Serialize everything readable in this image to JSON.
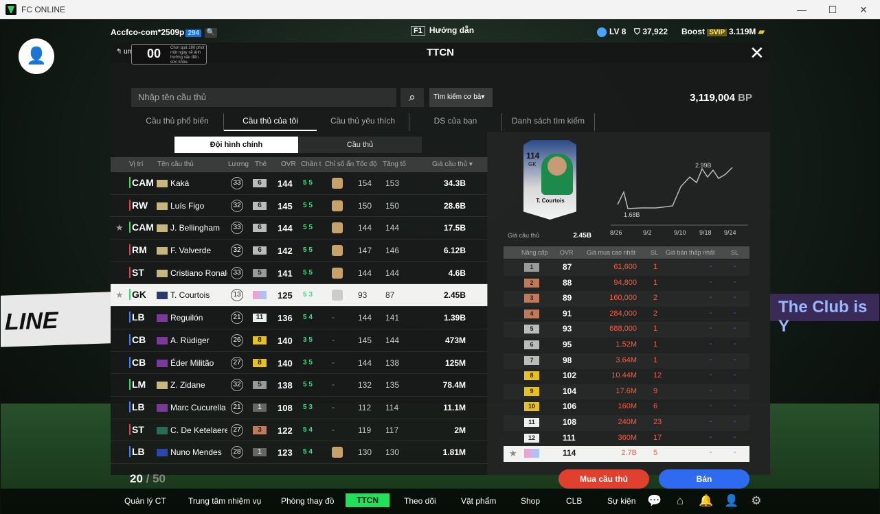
{
  "window": {
    "title": "FC ONLINE"
  },
  "top": {
    "account": "Accfco-com*2509p",
    "account_level": "294",
    "guide_key": "F1",
    "guide_label": "Hướng dẫn",
    "level": "LV 8",
    "coins": "37,922",
    "boost": "Boost",
    "svip": "SVIP",
    "bp": "3.119M"
  },
  "panel": {
    "title": "TTCN",
    "back_label": "ung tâ",
    "timer_big": "00",
    "timer_small": "Chơi quá 180 phút một ngày sẽ ảnh hưởng xấu đến sức khỏe.",
    "search_placeholder": "Nhập tên cầu thủ",
    "search_mode": "Tìm kiếm cơ bả",
    "bp_value": "3,119,004",
    "bp_unit": "BP"
  },
  "tabs": [
    "Cầu thủ phổ biến",
    "Cầu thủ của tôi",
    "Cầu thủ yêu thích",
    "DS của bạn",
    "Danh sách tìm kiếm"
  ],
  "subtabs": [
    "Đội hình chính",
    "Cầu thủ"
  ],
  "table_headers": {
    "pos": "Vị trí",
    "name": "Tên cầu thủ",
    "wage": "Lương",
    "season": "Thẻ",
    "ovr": "OVR",
    "foot": "Chân t",
    "chem": "Chỉ số ẩn",
    "spd": "Tốc độ",
    "acc": "Tăng tố",
    "price": "Giá cầu thủ ▾"
  },
  "players": [
    {
      "pos": "CAM",
      "name": "Kaká",
      "wage": "33",
      "lvl": "6",
      "ovr": "144",
      "foot": "5 5",
      "spd": "154",
      "acc": "153",
      "price": "34.3B"
    },
    {
      "pos": "RW",
      "name": "Luís Figo",
      "wage": "32",
      "lvl": "6",
      "ovr": "145",
      "foot": "5 5",
      "spd": "150",
      "acc": "150",
      "price": "28.6B"
    },
    {
      "pos": "CAM",
      "name": "J. Bellingham",
      "wage": "33",
      "lvl": "6",
      "ovr": "144",
      "foot": "5 5",
      "spd": "144",
      "acc": "144",
      "price": "17.5B"
    },
    {
      "pos": "RM",
      "name": "F. Valverde",
      "wage": "32",
      "lvl": "6",
      "ovr": "142",
      "foot": "5 5",
      "spd": "147",
      "acc": "146",
      "price": "6.12B"
    },
    {
      "pos": "ST",
      "name": "Cristiano Ronaldo",
      "wage": "33",
      "lvl": "5",
      "ovr": "141",
      "foot": "5 5",
      "spd": "144",
      "acc": "144",
      "price": "4.6B"
    },
    {
      "pos": "GK",
      "name": "T. Courtois",
      "wage": "13",
      "lvl": "",
      "ovr": "125",
      "foot": "5 3",
      "spd": "93",
      "acc": "87",
      "price": "2.45B"
    },
    {
      "pos": "LB",
      "name": "Reguilón",
      "wage": "21",
      "lvl": "11",
      "ovr": "136",
      "foot": "5 4",
      "spd": "144",
      "acc": "141",
      "price": "1.39B"
    },
    {
      "pos": "CB",
      "name": "A. Rüdiger",
      "wage": "26",
      "lvl": "8",
      "ovr": "140",
      "foot": "3 5",
      "spd": "145",
      "acc": "144",
      "price": "473M"
    },
    {
      "pos": "CB",
      "name": "Éder Militão",
      "wage": "27",
      "lvl": "8",
      "ovr": "140",
      "foot": "3 5",
      "spd": "144",
      "acc": "138",
      "price": "125M"
    },
    {
      "pos": "LM",
      "name": "Z. Zidane",
      "wage": "32",
      "lvl": "5",
      "ovr": "138",
      "foot": "5 5",
      "spd": "132",
      "acc": "135",
      "price": "78.4M"
    },
    {
      "pos": "LB",
      "name": "Marc Cucurella",
      "wage": "21",
      "lvl": "1",
      "ovr": "108",
      "foot": "5 3",
      "spd": "112",
      "acc": "114",
      "price": "11.1M"
    },
    {
      "pos": "ST",
      "name": "C. De Ketelaere",
      "wage": "27",
      "lvl": "3",
      "ovr": "122",
      "foot": "5 4",
      "spd": "119",
      "acc": "117",
      "price": "2M"
    },
    {
      "pos": "LB",
      "name": "Nuno Mendes",
      "wage": "28",
      "lvl": "1",
      "ovr": "123",
      "foot": "5 4",
      "spd": "130",
      "acc": "130",
      "price": "1.81M"
    }
  ],
  "pager": {
    "current": "20",
    "total": "/ 50"
  },
  "card": {
    "ovr": "114",
    "pos": "GK",
    "name": "T. Courtois",
    "price_label": "Giá cầu thủ",
    "price": "2.45B"
  },
  "chart_data": {
    "type": "line",
    "x": [
      "8/26",
      "9/2",
      "9/10",
      "9/18",
      "9/24"
    ],
    "label_max": "2.99B",
    "label_min": "1.68B"
  },
  "buy_table": {
    "headers": [
      "Nâng cấp",
      "OVR",
      "Giá mua cao nhất",
      "SL",
      "Giá bán thấp nhất",
      "SL"
    ],
    "rows": [
      {
        "lvl": "1",
        "ovr": "87",
        "price": "61,600",
        "qty": "1"
      },
      {
        "lvl": "2",
        "ovr": "88",
        "price": "94,800",
        "qty": "1"
      },
      {
        "lvl": "3",
        "ovr": "89",
        "price": "160,000",
        "qty": "2"
      },
      {
        "lvl": "4",
        "ovr": "91",
        "price": "284,000",
        "qty": "2"
      },
      {
        "lvl": "5",
        "ovr": "93",
        "price": "688,000",
        "qty": "1"
      },
      {
        "lvl": "6",
        "ovr": "95",
        "price": "1.52M",
        "qty": "1"
      },
      {
        "lvl": "7",
        "ovr": "98",
        "price": "3.64M",
        "qty": "1"
      },
      {
        "lvl": "8",
        "ovr": "102",
        "price": "10.44M",
        "qty": "12"
      },
      {
        "lvl": "9",
        "ovr": "104",
        "price": "17.6M",
        "qty": "9"
      },
      {
        "lvl": "10",
        "ovr": "106",
        "price": "160M",
        "qty": "6"
      },
      {
        "lvl": "11",
        "ovr": "108",
        "price": "240M",
        "qty": "23"
      },
      {
        "lvl": "12",
        "ovr": "111",
        "price": "360M",
        "qty": "17"
      },
      {
        "lvl": "",
        "ovr": "114",
        "price": "2.7B",
        "qty": "5"
      }
    ],
    "dash": "-"
  },
  "actions": {
    "buy": "Mua cầu thủ",
    "sell": "Bán"
  },
  "bottom_nav": [
    "Quản lý CT",
    "Trung tâm nhiệm vụ",
    "Phòng thay đồ",
    "TTCN",
    "Theo dõi",
    "Vật phẩm",
    "Shop",
    "CLB",
    "Sự kiện"
  ],
  "background": {
    "banner_left": "LINE",
    "banner_right": "The Club is Y"
  }
}
